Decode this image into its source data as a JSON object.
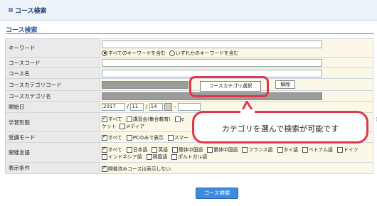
{
  "header": {
    "title": "コース検索"
  },
  "section": {
    "title": "コース検索"
  },
  "rows": {
    "keyword": {
      "label": "キーワード",
      "radio_all": "すべてのキーワードを含む",
      "radio_any": "いずれかのキーワードを含む"
    },
    "course_code": {
      "label": "コースコード"
    },
    "course_name": {
      "label": "コース名"
    },
    "category_code": {
      "label": "コースカテゴリコード",
      "select_label": "コースカテゴリ選択",
      "clear_label": "解除"
    },
    "category_name": {
      "label": "コースカテゴリ名"
    },
    "start_date": {
      "label": "開始日",
      "year": "2017",
      "month": "11",
      "day": "14",
      "sep1": "/",
      "sep2": "/",
      "range_sep": "-"
    },
    "learning_form": {
      "label": "学習形態",
      "opt_all": "すべて",
      "opt_seminar": "講習会(集合教育)",
      "opt_e": "e",
      "line2_start": "ケット",
      "opt_media": "メディア",
      "tail": "ﾃ"
    },
    "attendance_mode": {
      "label": "受講モード",
      "opt_all": "すべて",
      "opt_pc": "PCのみで表示",
      "opt_smart": "スマー"
    },
    "language": {
      "label": "開催言語",
      "options1": [
        "すべて",
        "日本語",
        "英語",
        "簡体中国語",
        "繁体中国語",
        "フランス語",
        "タイ語",
        "ベトナム語",
        "ドイツ"
      ],
      "options2": [
        "インドネシア語",
        "韓国語",
        "ポルトガル語"
      ]
    },
    "display_condition": {
      "label": "表示条件",
      "opt_hide": "開催済みコースは表示しない"
    }
  },
  "search_button": "コース検索",
  "callout": {
    "text": "カテゴリを選んで検索が可能です"
  }
}
